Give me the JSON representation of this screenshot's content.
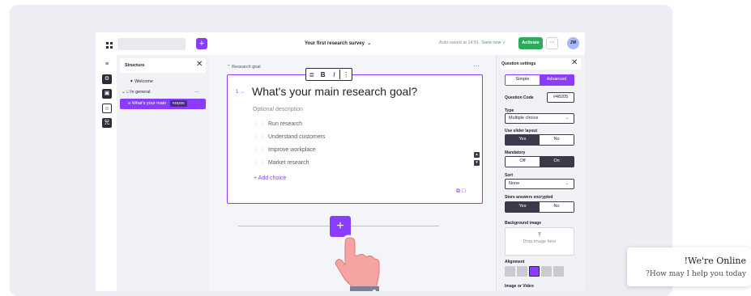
{
  "topbar": {
    "survey_title": "Your first research survey",
    "autosave_text": "Auto-saved at 14:51.",
    "save_now": "Save now",
    "activate_label": "Activate",
    "more_label": "···",
    "avatar_initials": "JW",
    "add_label": "+"
  },
  "structure": {
    "title": "Structure",
    "items": [
      {
        "label": "Welcome"
      },
      {
        "label": "In general"
      },
      {
        "label": "What's your main",
        "code": "#48205"
      }
    ],
    "more_label": "···"
  },
  "editor": {
    "section_label": "Research goal",
    "section_more": "···",
    "toolbar": {
      "align": "≣",
      "bold": "B",
      "italic": "I",
      "more": "⋮"
    },
    "question_number": "1 →",
    "question_text": "What's your main research goal?",
    "description_placeholder": "Optional description",
    "choices": [
      "Run research",
      "Understand customers",
      "Improve workplace",
      "Market research"
    ],
    "add_choice": "+ Add choice",
    "add_question": "+"
  },
  "settings": {
    "title": "Question settings",
    "mode_simple": "Simple",
    "mode_advanced": "Advanced",
    "code_label": "Question Code",
    "code_value": "#48205",
    "type_label": "Type",
    "type_value": "Multiple choice",
    "slider_label": "Use slider layout",
    "slider_yes": "Yes",
    "slider_no": "No",
    "mandatory_label": "Mandatory",
    "mandatory_off": "Off",
    "mandatory_on": "On",
    "sort_label": "Sort",
    "sort_value": "None",
    "encrypted_label": "Store answers encrypted",
    "encrypted_yes": "Yes",
    "encrypted_no": "No",
    "background_label": "Background image",
    "drop_text": "Drop image here",
    "alignment_label": "Alignment",
    "image_video_label": "Image or Video"
  },
  "chat": {
    "title": "!We're Online",
    "subtitle": "?How may I help you today"
  },
  "colors": {
    "accent": "#8b3dff",
    "success": "#2eaa5a",
    "dark": "#2b2b3a"
  }
}
